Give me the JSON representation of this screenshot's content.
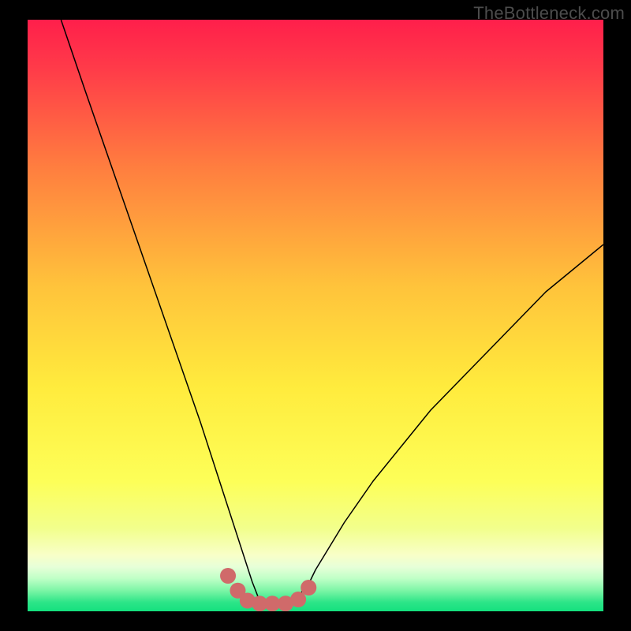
{
  "watermark": "TheBottleneck.com",
  "chart_data": {
    "type": "line",
    "title": "",
    "xlabel": "",
    "ylabel": "",
    "xlim": [
      0,
      100
    ],
    "ylim": [
      0,
      100
    ],
    "background_gradient": {
      "top": "#FF1F4B",
      "mid1": "#FFB93A",
      "mid2": "#FFF23E",
      "mid3": "#F5FF7A",
      "bottom": "#14E07E"
    },
    "series": [
      {
        "name": "bottleneck-curve",
        "stroke": "#000000",
        "stroke_width": 1.5,
        "x": [
          5.8,
          10,
          15,
          20,
          25,
          30,
          33,
          35,
          37,
          39,
          40,
          41.5,
          43,
          45,
          47,
          49,
          50,
          55,
          60,
          65,
          70,
          75,
          80,
          85,
          90,
          95,
          100
        ],
        "values": [
          100,
          88,
          74,
          60,
          46,
          32,
          23,
          17,
          11,
          5,
          2.5,
          1.5,
          1.5,
          1.5,
          2.5,
          5,
          7,
          15,
          22,
          28,
          34,
          39,
          44,
          49,
          54,
          58,
          62
        ]
      },
      {
        "name": "bottom-dots",
        "type": "scatter",
        "color": "#D06A6A",
        "radius": 10,
        "x": [
          34.8,
          36.5,
          38.2,
          40.3,
          42.5,
          44.8,
          47.0,
          48.8
        ],
        "values": [
          6.0,
          3.5,
          1.8,
          1.3,
          1.3,
          1.3,
          2.0,
          4.0
        ]
      }
    ]
  }
}
